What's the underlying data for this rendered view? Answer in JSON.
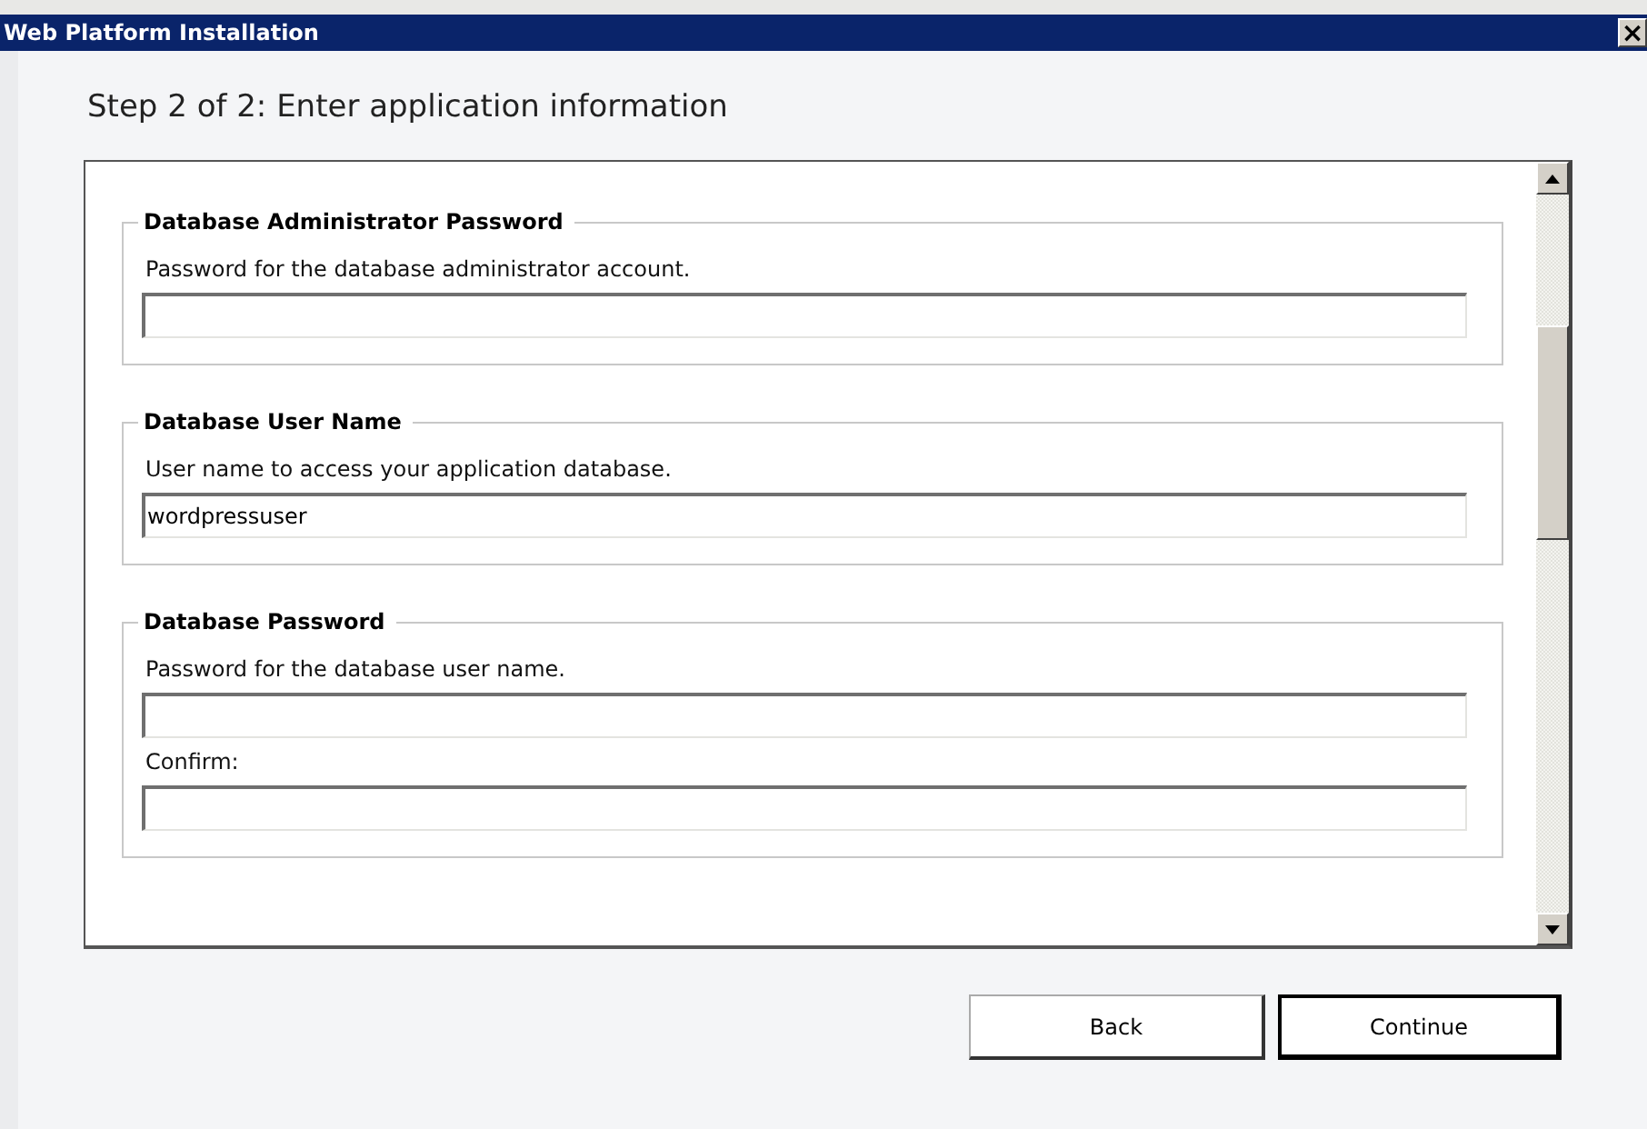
{
  "window": {
    "title": "Web Platform Installation",
    "close": "×"
  },
  "heading": "Step 2 of 2: Enter application information",
  "groups": [
    {
      "title": "Database Administrator Password",
      "fields": [
        {
          "kind": "text",
          "text": "Password for the database administrator account."
        },
        {
          "kind": "input"
        }
      ]
    },
    {
      "title": "Database User Name",
      "fields": [
        {
          "kind": "text",
          "text": "User name to access your application database."
        },
        {
          "kind": "input",
          "value": "wordpressuser"
        }
      ]
    },
    {
      "title": "Database Password",
      "fields": [
        {
          "kind": "text",
          "text": "Password for the database user name."
        },
        {
          "kind": "input"
        },
        {
          "kind": "text",
          "text": "Confirm:"
        },
        {
          "kind": "input"
        }
      ]
    }
  ],
  "buttons": [
    {
      "label": "Back",
      "default": false
    },
    {
      "label": "Continue",
      "default": true
    }
  ]
}
